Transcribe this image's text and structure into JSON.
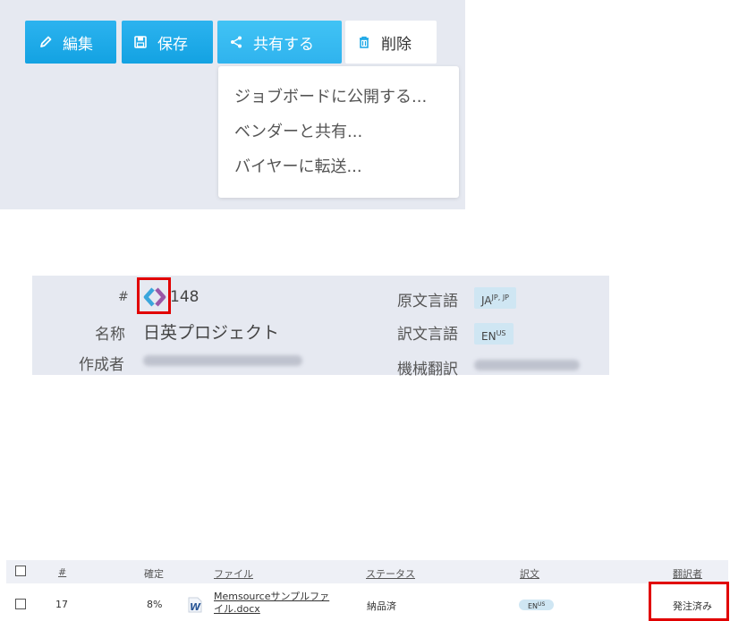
{
  "toolbar": {
    "buttons": {
      "edit": {
        "label": "編集",
        "icon": "pencil-icon"
      },
      "save": {
        "label": "保存",
        "icon": "floppy-disk-icon"
      },
      "share": {
        "label": "共有する",
        "icon": "share-icon"
      },
      "delete": {
        "label": "削除",
        "icon": "trash-icon"
      }
    },
    "share_menu": [
      "ジョブボードに公開する...",
      "ベンダーと共有...",
      "バイヤーに転送..."
    ]
  },
  "project": {
    "id_label": "#",
    "id_value": "148",
    "name_label": "名称",
    "name_value": "日英プロジェクト",
    "created_by_label": "作成者",
    "source_lang_label": "原文言語",
    "source_lang": {
      "code": "JA",
      "variant": "JP, JP"
    },
    "target_lang_label": "訳文言語",
    "target_lang": {
      "code": "EN",
      "variant": "US"
    },
    "mt_label": "機械翻訳",
    "logo_icon": "memsource-logo-icon"
  },
  "files_table": {
    "headers": [
      "#",
      "確定",
      "ファイル",
      "ステータス",
      "訳文",
      "翻訳者"
    ],
    "rows": [
      {
        "number": "17",
        "confirmed": "8%",
        "file_icon": "word-doc-icon",
        "file_name": "Memsourceサンプルファイル.docx",
        "status": "納品済",
        "target_code": "EN",
        "target_variant": "US",
        "translator": "発注済み"
      }
    ]
  },
  "colors": {
    "button_blue": "#13a2e2",
    "panel_bg": "#e6e9f1",
    "highlight_red": "#e10000",
    "badge_bg": "#cfe6f3"
  }
}
